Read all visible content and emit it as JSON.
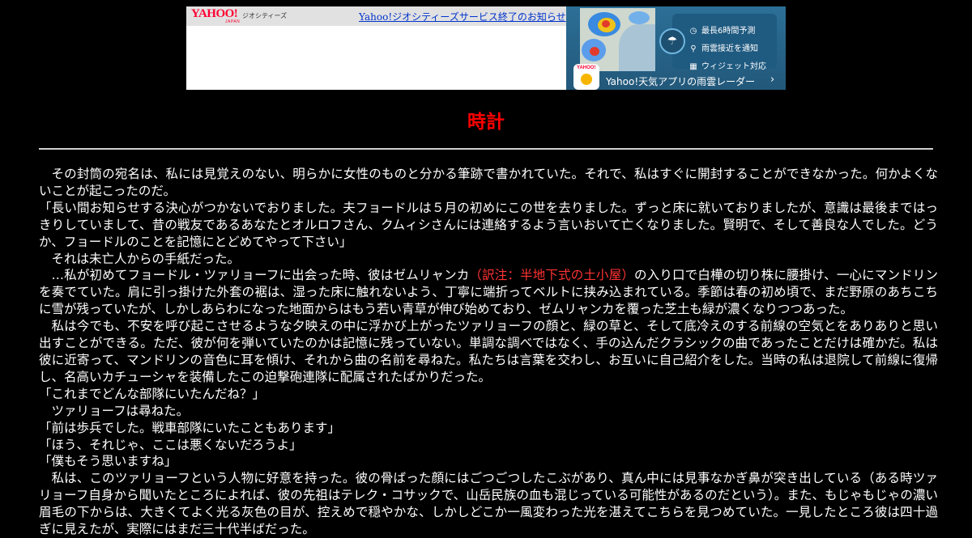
{
  "banner": {
    "logo_main": "YAHOO!",
    "logo_sub": "JAPAN",
    "service_label": "ジオシティーズ",
    "notice_link": "Yahoo!ジオシティーズサービス終了のお知らせ"
  },
  "ad": {
    "features": [
      {
        "icon": "clock-icon",
        "glyph": "◷",
        "label": "最長6時間予測"
      },
      {
        "icon": "pin-icon",
        "glyph": "⚲",
        "label": "雨雲接近を通知"
      },
      {
        "icon": "widget-icon",
        "glyph": "▦",
        "label": "ウィジェット対応"
      }
    ],
    "app_icon_text": "YAHOO!",
    "footer": "Yahoo!天気アプリの雨雲レーダー",
    "arrow": "›"
  },
  "page": {
    "title": "時計",
    "title_color": "#ff0000",
    "background": "#000000",
    "paragraphs": [
      {
        "text": "その封筒の宛名は、私には見覚えのない、明らかに女性のものと分かる筆跡で書かれていた。それで、私はすぐに開封することができなかった。何かよくないことが起こったのだ。"
      },
      {
        "text": "「長い間お知らせする決心がつかないでおりました。夫フョードルは５月の初めにこの世を去りました。ずっと床に就いておりましたが、意識は最後まではっきりしていまして、昔の戦友であるあなたとオルロフさん、クムィシさんには連絡するよう言いおいて亡くなりました。賢明で、そして善良な人でした。どうか、フョードルのことを記憶にとどめてやって下さい」"
      },
      {
        "text": "それは未亡人からの手紙だった。"
      },
      {
        "before": "…私が初めてフョードル・ツァリョーフに出会った時、彼はゼムリャンカ",
        "note": "（訳注：半地下式の土小屋）",
        "after": "の入り口で白樺の切り株に腰掛け、一心にマンドリンを奏でていた。肩に引っ掛けた外套の裾は、湿った床に触れないよう、丁寧に端折ってベルトに挟み込まれている。季節は春の初め頃で、まだ野原のあちこちに雪が残っていたが、しかしあらわになった地面からはもう若い青草が伸び始めており、ゼムリャンカを覆った芝土も緑が濃くなりつつあった。"
      },
      {
        "text": "私は今でも、不安を呼び起こさせるような夕映えの中に浮かび上がったツァリョーフの顔と、緑の草と、そして底冷えのする前線の空気とをありありと思い出すことができる。ただ、彼が何を弾いていたのかは記憶に残っていない。単調な調べではなく、手の込んだクラシックの曲であったことだけは確かだ。私は彼に近寄って、マンドリンの音色に耳を傾け、それから曲の名前を尋ねた。私たちは言葉を交わし、お互いに自己紹介をした。当時の私は退院して前線に復帰し、名高いカチューシャを装備したこの迫撃砲連隊に配属されたばかりだった。"
      },
      {
        "text": "「これまでどんな部隊にいたんだね？」"
      },
      {
        "text": "ツァリョーフは尋ねた。"
      },
      {
        "text": "「前は歩兵でした。戦車部隊にいたこともあります」"
      },
      {
        "text": "「ほう、それじゃ、ここは悪くないだろうよ」"
      },
      {
        "text": "「僕もそう思いますね」"
      },
      {
        "text": "私は、このツァリョーフという人物に好意を持った。彼の骨ばった顔にはごつごつしたこぶがあり、真ん中には見事なかぎ鼻が突き出している（ある時ツァリョーフ自身から聞いたところによれば、彼の先祖はテレク・コサックで、山岳民族の血も混じっている可能性があるのだという）。また、もじゃもじゃの濃い眉毛の下からは、大きくてよく光る灰色の目が、控えめで穏やかな、しかしどこか一風変わった光を湛えてこちらを見つめていた。一見したところ彼は四十過ぎに見えたが、実際にはまだ三十代半ばだった。"
      }
    ]
  }
}
